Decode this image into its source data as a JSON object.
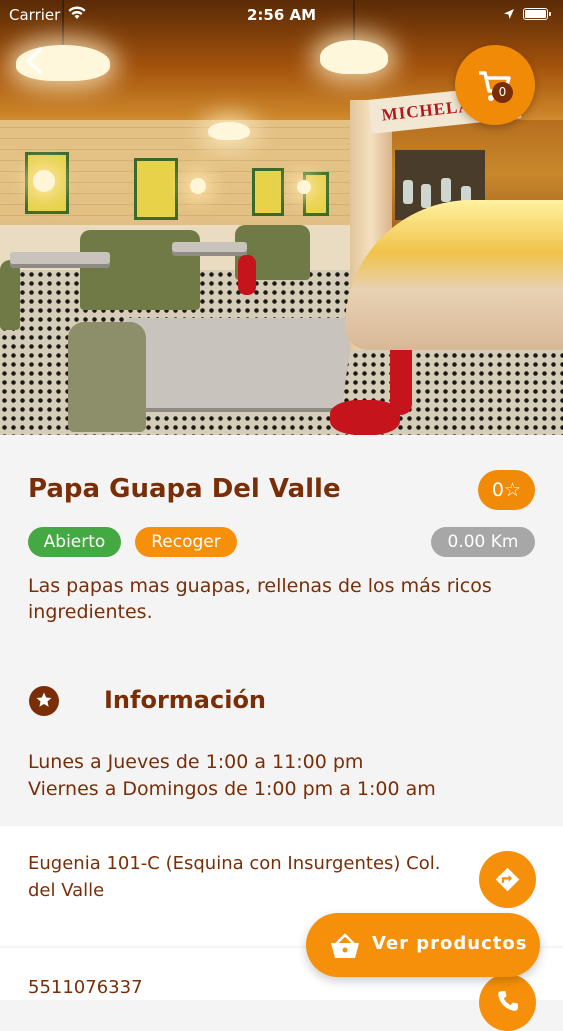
{
  "status_bar": {
    "carrier": "Carrier",
    "time": "2:56 AM"
  },
  "hero": {
    "sign_text": "MICHELADAS"
  },
  "cart": {
    "count": "0"
  },
  "restaurant": {
    "name": "Papa Guapa Del Valle",
    "rating": "0",
    "status": "Abierto",
    "service": "Recoger",
    "distance": "0.00 Km",
    "description": "Las papas mas guapas, rellenas de los más ricos ingredientes."
  },
  "info": {
    "title": "Información",
    "hours_line1": "Lunes a Jueves de 1:00 a 11:00 pm",
    "hours_line2": "Viernes a Domingos de 1:00 pm a 1:00 am",
    "address": "Eugenia 101-C (Esquina con Insurgentes) Col. del Valle",
    "phone": "5511076337"
  },
  "actions": {
    "view_products": "Ver productos"
  },
  "colors": {
    "brand_orange": "#f6900a",
    "brand_brown": "#7a2e07",
    "open_green": "#44a843",
    "distance_gray": "#a7a7a7"
  }
}
